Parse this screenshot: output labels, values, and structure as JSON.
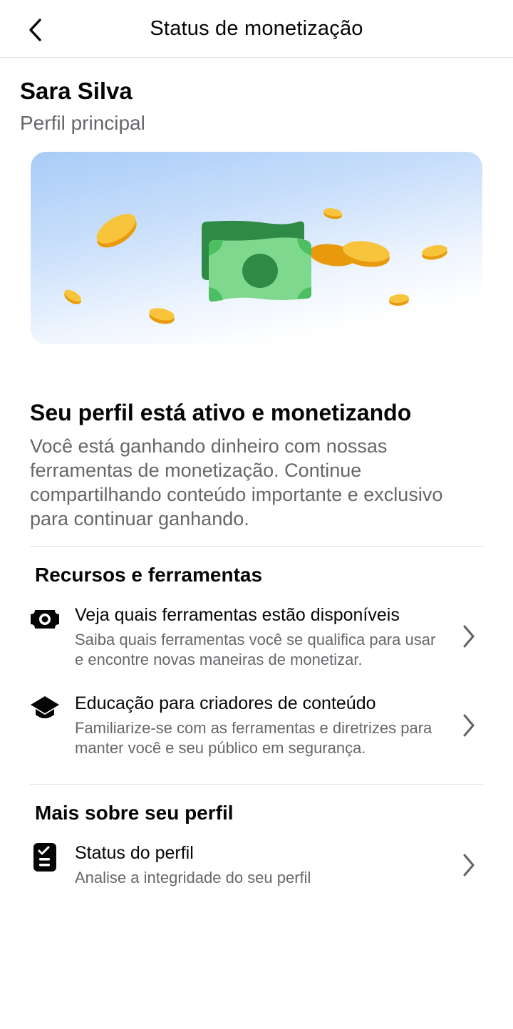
{
  "header": {
    "title": "Status de monetização",
    "back_icon": "chevron-left-icon"
  },
  "profile": {
    "name": "Sara Silva",
    "subtitle": "Perfil principal"
  },
  "hero": {
    "illustration": "money-bills-coins-illustration"
  },
  "status": {
    "title": "Seu perfil está ativo e monetizando",
    "description": "Você está ganhando dinheiro com nossas ferramentas de monetização. Continue compartilhando conteúdo importante e exclusivo para continuar ganhando."
  },
  "resources": {
    "title": "Recursos e ferramentas",
    "items": [
      {
        "icon": "money-icon",
        "title": "Veja quais ferramentas estão disponíveis",
        "subtitle": "Saiba quais ferramentas você se qualifica para usar e encontre novas maneiras de monetizar."
      },
      {
        "icon": "graduation-cap-icon",
        "title": "Educação para criadores de conteúdo",
        "subtitle": "Familiarize-se com as ferramentas e diretrizes para manter você e seu público em segurança."
      }
    ]
  },
  "more": {
    "title": "Mais sobre seu perfil",
    "items": [
      {
        "icon": "clipboard-check-icon",
        "title": "Status do perfil",
        "subtitle": "Analise a integridade do seu perfil"
      }
    ]
  },
  "colors": {
    "text_primary": "#050505",
    "text_secondary": "#65676b",
    "divider": "#dadde1",
    "money_green": "#54c56b",
    "coin_gold": "#f7b928"
  }
}
